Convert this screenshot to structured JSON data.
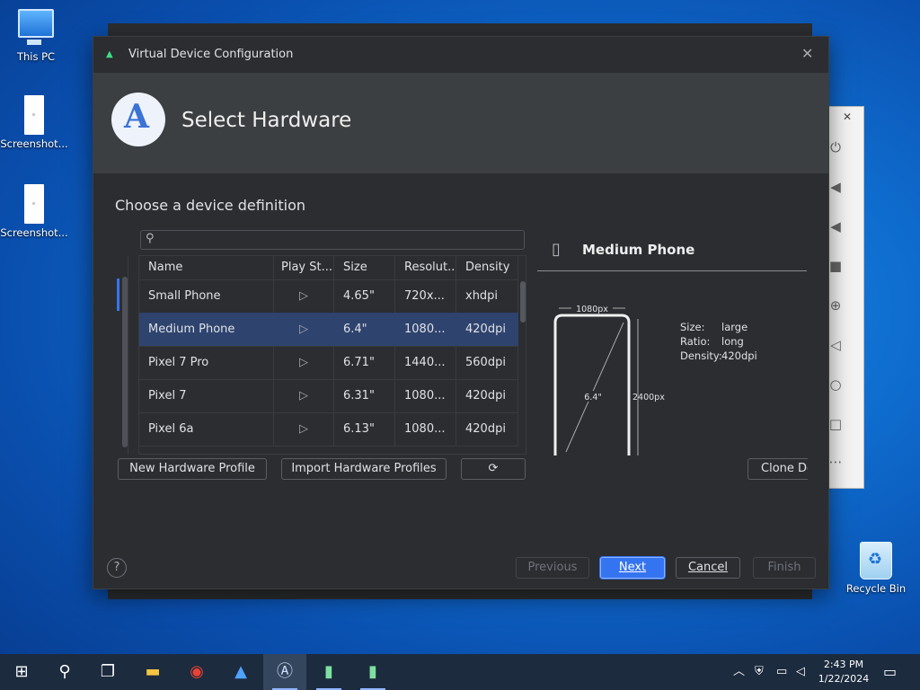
{
  "desktop": {
    "icons": [
      {
        "label": "This PC"
      },
      {
        "label": "Screenshot..."
      },
      {
        "label": "Screenshot..."
      },
      {
        "label": "Recycle Bin"
      }
    ]
  },
  "dialog": {
    "title": "Virtual Device Configuration",
    "header_title": "Select Hardware",
    "subtitle": "Choose a device definition",
    "search": {
      "placeholder": "",
      "value": ""
    },
    "table": {
      "columns": [
        "Name",
        "Play St...",
        "Size",
        "Resolut...",
        "Density"
      ],
      "rows": [
        {
          "name": "Small Phone",
          "size": "4.65\"",
          "resolution": "720x...",
          "density": "xhdpi"
        },
        {
          "name": "Medium Phone",
          "size": "6.4\"",
          "resolution": "1080...",
          "density": "420dpi"
        },
        {
          "name": "Pixel 7 Pro",
          "size": "6.71\"",
          "resolution": "1440...",
          "density": "560dpi"
        },
        {
          "name": "Pixel 7",
          "size": "6.31\"",
          "resolution": "1080...",
          "density": "420dpi"
        },
        {
          "name": "Pixel 6a",
          "size": "6.13\"",
          "resolution": "1080...",
          "density": "420dpi"
        }
      ],
      "selected_row": 1
    },
    "buttons": {
      "new_profile": "New Hardware Profile",
      "import_profiles": "Import Hardware Profiles",
      "clone": "Clone De"
    },
    "preview": {
      "device_name": "Medium Phone",
      "width_label": "1080px",
      "height_label": "2400px",
      "diagonal_label": "6.4\"",
      "specs": [
        {
          "key": "Size:",
          "value": "large"
        },
        {
          "key": "Ratio:",
          "value": "long"
        },
        {
          "key": "Density:",
          "value": "420dpi"
        }
      ]
    },
    "footer": {
      "help": "?",
      "previous": "Previous",
      "next": "Next",
      "cancel": "Cancel",
      "finish": "Finish"
    }
  },
  "taskbar": {
    "time": "2:43 PM",
    "date": "1/22/2024"
  }
}
